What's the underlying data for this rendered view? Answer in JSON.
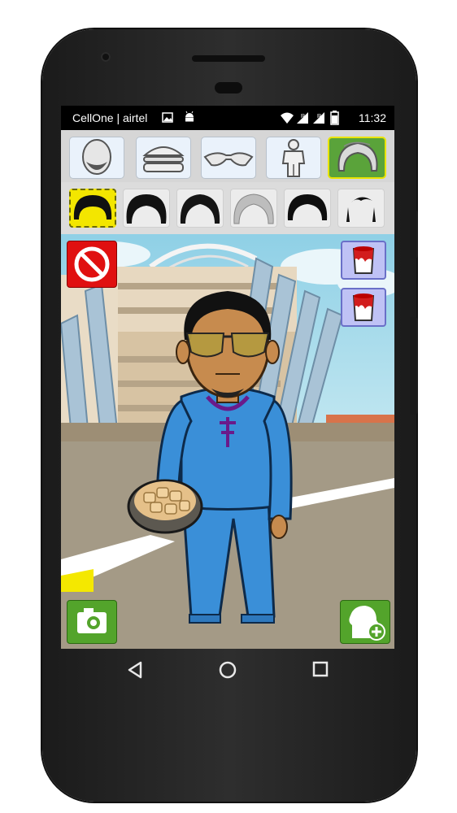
{
  "status_bar": {
    "carrier": "CellOne | airtel",
    "time": "11:32",
    "icons": [
      "image-icon",
      "android-icon",
      "wifi-icon",
      "signal-icon",
      "signal-icon",
      "battery-icon"
    ]
  },
  "categories": [
    {
      "name": "face-category",
      "icon": "face-shape-icon",
      "selected": false
    },
    {
      "name": "food-category",
      "icon": "burger-icon",
      "selected": false
    },
    {
      "name": "glasses-category",
      "icon": "sunglasses-icon",
      "selected": false
    },
    {
      "name": "outfit-category",
      "icon": "outfit-icon",
      "selected": false
    },
    {
      "name": "hair-category",
      "icon": "hair-icon",
      "selected": true
    }
  ],
  "hair_options": [
    {
      "style": "short-black",
      "selected": true
    },
    {
      "style": "medium-black",
      "selected": false
    },
    {
      "style": "medium-black-2",
      "selected": false
    },
    {
      "style": "grey",
      "selected": false
    },
    {
      "style": "short-black-2",
      "selected": false
    },
    {
      "style": "sparse-black",
      "selected": false
    }
  ],
  "controls": {
    "remove": "no-entry-icon",
    "paint_1": "paint-bucket-icon",
    "paint_2": "paint-bucket-icon",
    "camera": "camera-icon",
    "add_avatar": "add-head-icon"
  },
  "colors": {
    "selected_hair": "#f3e600",
    "selected_category": "#5aa33a",
    "remove_button": "#e01010",
    "paint_button": "#bfc2f5",
    "action_button": "#53a42b",
    "outfit": "#3a8fd8"
  },
  "nav": [
    "back-icon",
    "home-icon",
    "recents-icon"
  ]
}
